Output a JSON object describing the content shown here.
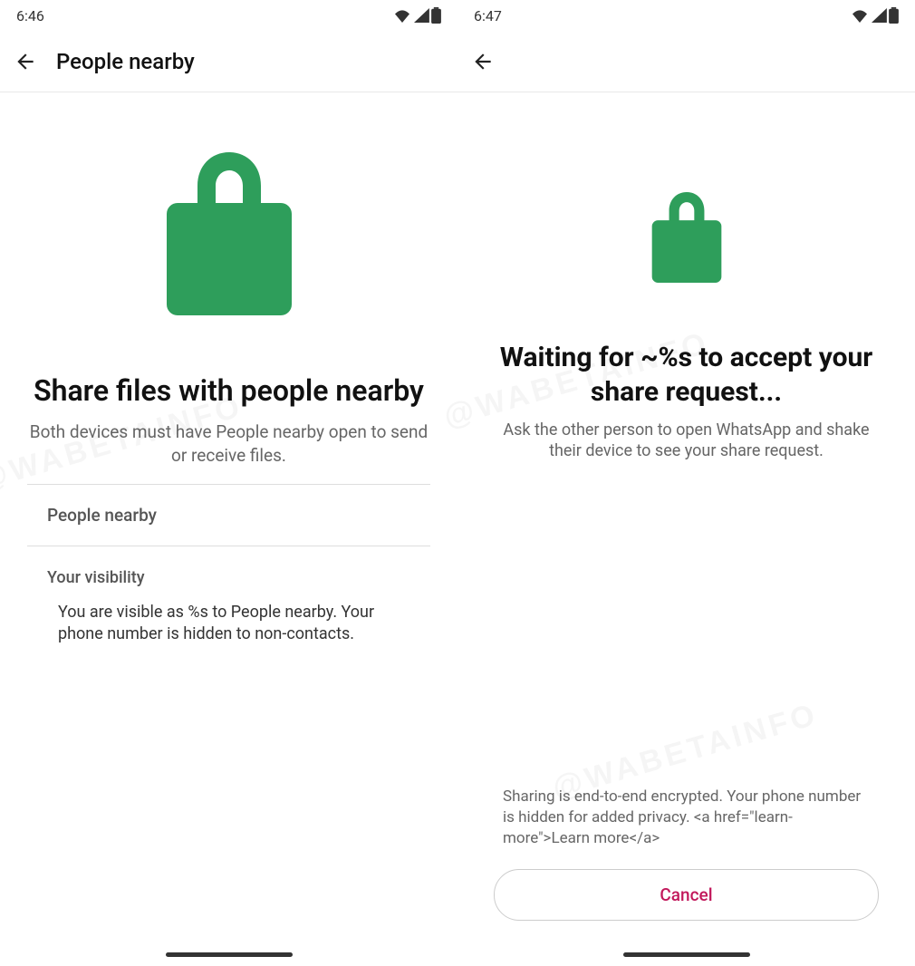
{
  "watermark": "@WABETAINFO",
  "left": {
    "status_time": "6:46",
    "app_bar_title": "People nearby",
    "headline": "Share files with people nearby",
    "subtext": "Both devices must have People nearby open to send or receive files.",
    "section_people_nearby": "People nearby",
    "visibility_title": "Your visibility",
    "visibility_body": "You are visible as %s to People nearby. Your phone number is hidden to non-contacts."
  },
  "right": {
    "status_time": "6:47",
    "headline": "Waiting for ~%s to accept your share request...",
    "subtext": "Ask the other person to open WhatsApp and shake their device to see your share request.",
    "privacy_text": "Sharing is end-to-end encrypted. Your phone number is hidden for added privacy. <a href=\"learn-more\">Learn more</a>",
    "cancel_label": "Cancel"
  },
  "colors": {
    "lock_green": "#2e9e5b",
    "cancel_red": "#c2185b"
  }
}
